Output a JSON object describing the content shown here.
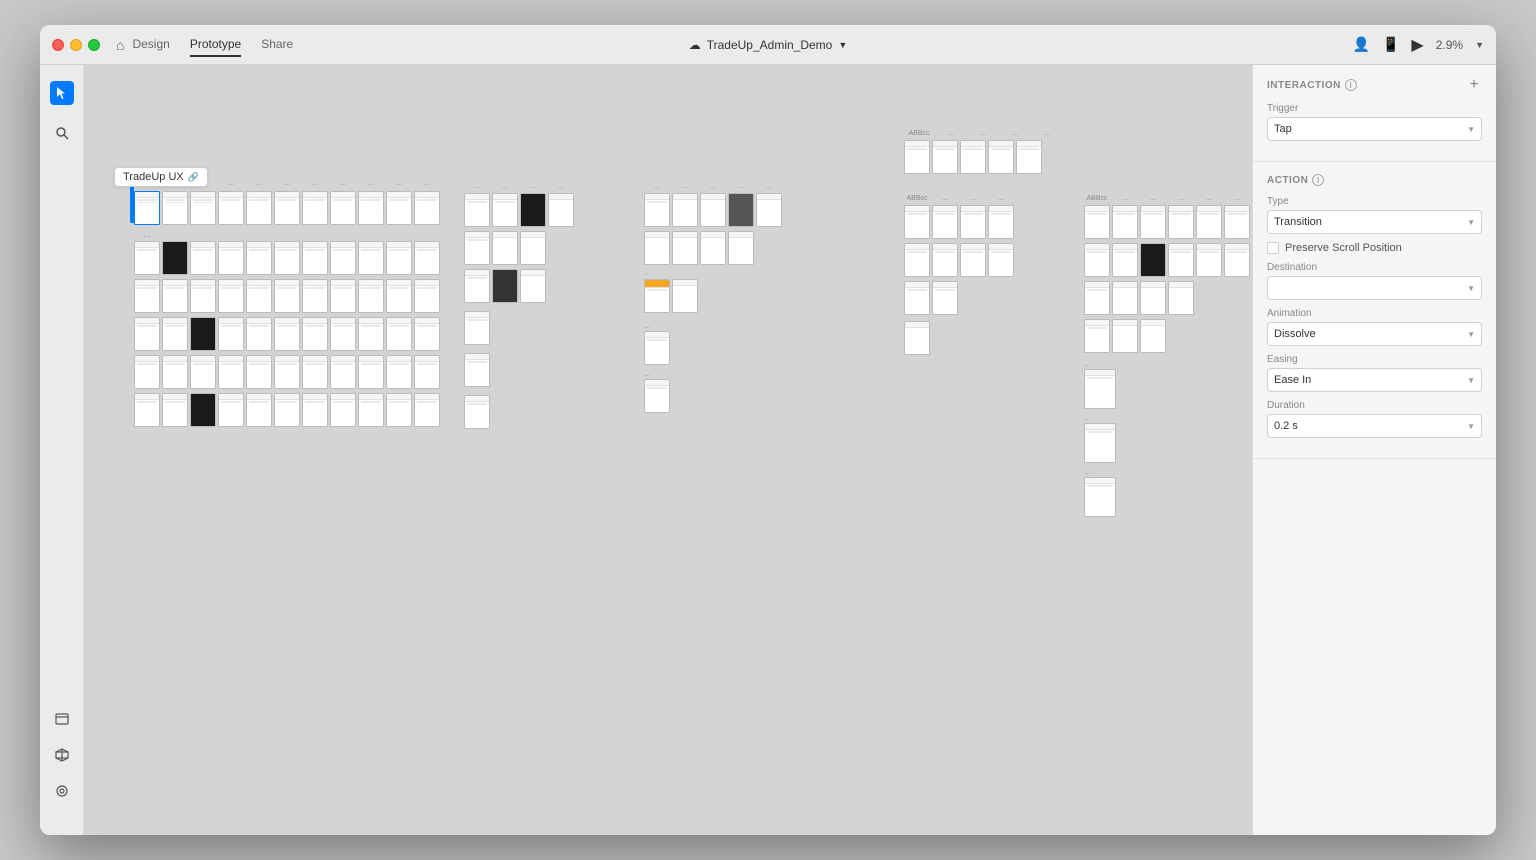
{
  "window": {
    "title": "TradeUp_Admin_Demo",
    "zoom": "2.9%"
  },
  "titlebar": {
    "nav_items": [
      "Design",
      "Prototype",
      "Share"
    ],
    "active_tab": "Prototype",
    "home_label": "home",
    "play_label": "▶",
    "account_icons": [
      "person",
      "device",
      "play"
    ]
  },
  "frame_label": {
    "text": "TradeUp UX",
    "link_icon": "🔗"
  },
  "right_panel": {
    "interaction_title": "INTERACTION",
    "add_label": "+",
    "trigger_label": "Trigger",
    "trigger_value": "Tap",
    "action_title": "ACTION",
    "action_info": "ⓘ",
    "type_label": "Type",
    "type_value": "Transition",
    "preserve_scroll_label": "Preserve Scroll Position",
    "destination_label": "Destination",
    "animation_label": "Animation",
    "animation_value": "Dissolve",
    "easing_label": "Easing",
    "easing_value": "Ease In",
    "duration_label": "Duration",
    "duration_value": "0.2 s"
  },
  "tools": {
    "pointer": "▲",
    "zoom": "🔍",
    "bottom": [
      "□",
      "◈",
      "👤"
    ]
  }
}
